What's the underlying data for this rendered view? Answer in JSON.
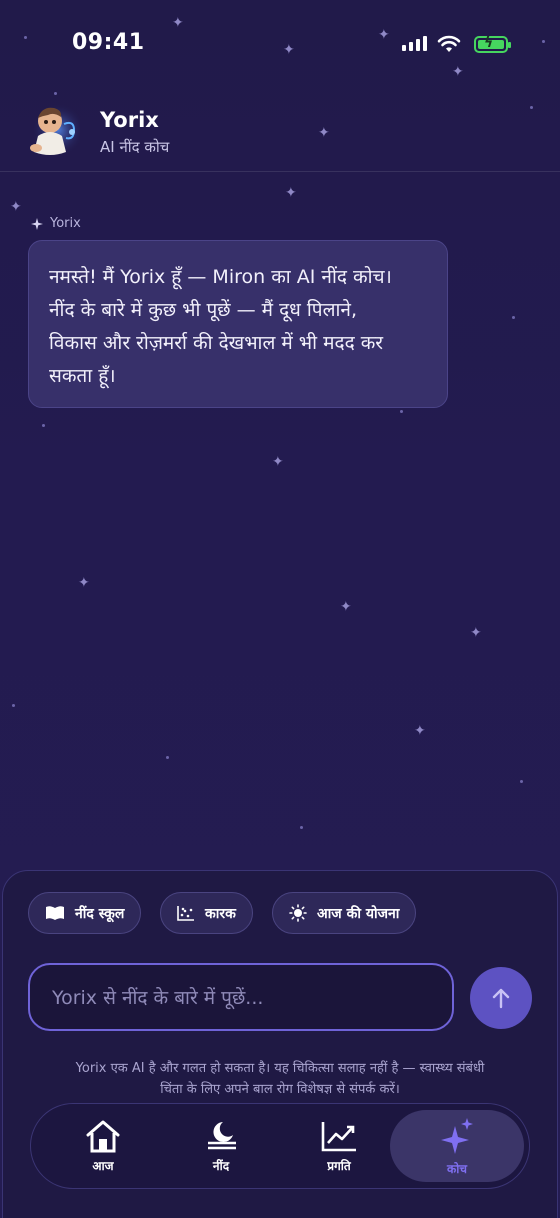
{
  "status_bar": {
    "time": "09:41"
  },
  "header": {
    "name": "Yorix",
    "subtitle": "AI नींद कोच"
  },
  "message": {
    "sender": "Yorix",
    "lines": [
      "नमस्ते! मैं Yorix हूँ — Miron का AI नींद कोच।",
      "नींद के बारे में कुछ भी पूछें — मैं दूध पिलाने,",
      "विकास और रोज़मर्रा की देखभाल में भी मदद कर",
      "सकता हूँ।"
    ]
  },
  "chips": [
    {
      "label": "नींद स्कूल",
      "icon": "book-icon"
    },
    {
      "label": "कारक",
      "icon": "scatter-chart-icon"
    },
    {
      "label": "आज की योजना",
      "icon": "sun-icon"
    }
  ],
  "composer": {
    "placeholder": "Yorix से नींद के बारे में पूछें..."
  },
  "disclaimer": {
    "line1": "Yorix एक AI है और गलत हो सकता है। यह चिकित्सा सलाह नहीं है — स्वास्थ्य संबंधी",
    "line2": "चिंता के लिए अपने बाल रोग विशेषज्ञ से संपर्क करें।"
  },
  "tabs": [
    {
      "label": "आज",
      "icon": "home-icon"
    },
    {
      "label": "नींद",
      "icon": "moon-icon"
    },
    {
      "label": "प्रगति",
      "icon": "trend-chart-icon"
    },
    {
      "label": "कोच",
      "icon": "sparkle-icon",
      "active": true
    }
  ],
  "colors": {
    "accent": "#7f6ff0",
    "background": "#221b4d",
    "bubble": "#37306a",
    "battery": "#46d65f"
  }
}
